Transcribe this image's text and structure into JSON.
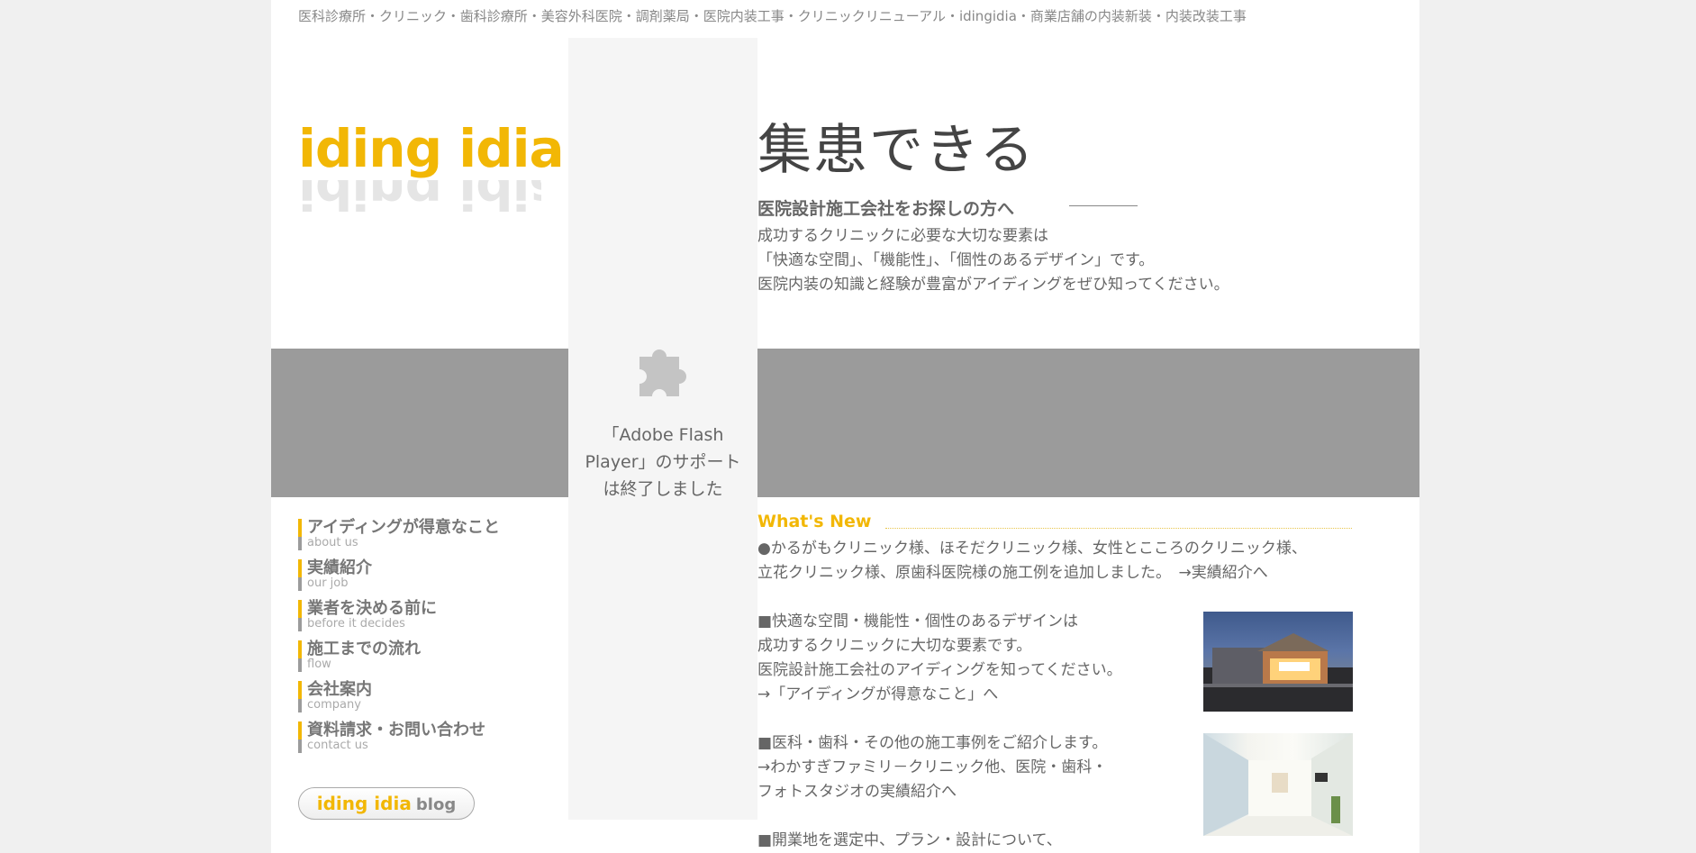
{
  "header": {
    "tagline": "医科診療所・クリニック・歯科診療所・美容外科医院・調剤薬局・医院内装工事・クリニックリニューアル・idingidia・商業店舗の内装新装・内装改装工事"
  },
  "logo": {
    "text": "iding idia"
  },
  "flash": {
    "message": "「Adobe Flash Player」のサポートは終了しました"
  },
  "hero": {
    "headline": "集患できる",
    "subhead": "医院設計施工会社をお探しの方へ",
    "lines": [
      "成功するクリニックに必要な大切な要素は",
      "「快適な空間」、「機能性」、「個性のあるデザイン」です。",
      "医院内装の知識と経験が豊富がアイディングをぜひ知ってください。"
    ]
  },
  "nav": {
    "items": [
      {
        "jp": "アイディングが得意なこと",
        "en": "about us"
      },
      {
        "jp": "実績紹介",
        "en": "our job"
      },
      {
        "jp": "業者を決める前に",
        "en": "before it decides"
      },
      {
        "jp": "施工までの流れ",
        "en": "flow"
      },
      {
        "jp": "会社案内",
        "en": "company"
      },
      {
        "jp": "資料請求・お問い合わせ",
        "en": "contact us"
      }
    ]
  },
  "blog": {
    "brand": "iding idia",
    "label": "blog"
  },
  "news": {
    "title": "What's New",
    "item1_line1": "●かるがもクリニック様、ほそだクリニック様、女性とこころのクリニック様、",
    "item1_line2": "立花クリニック様、原歯科医院様の施工例を追加しました。　",
    "item1_link": "→実績紹介へ",
    "item2_line1": "■快適な空間・機能性・個性のあるデザインは",
    "item2_line2": "成功するクリニックに大切な要素です。",
    "item2_line3": "医院設計施工会社のアイディングを知ってください。",
    "item2_link": "→「アイディングが得意なこと」へ",
    "item3_line1": "■医科・歯科・その他の施工事例をご紹介します。",
    "item3_link_line1": "→わかすぎファミリ－クリニック他、医院・歯科・",
    "item3_link_line2": "フォトスタジオの実績紹介へ",
    "item4_line1": "■開業地を選定中、プラン・設計について、"
  }
}
